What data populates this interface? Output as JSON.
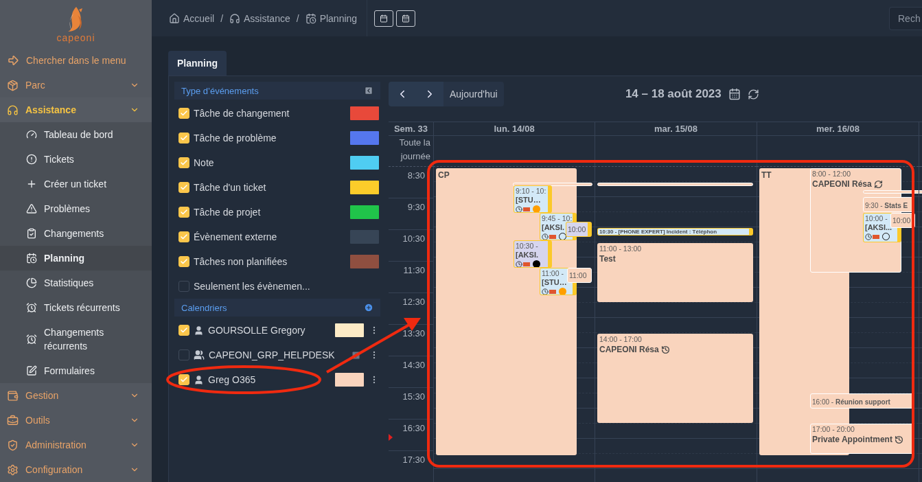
{
  "sidebar": {
    "logo": "capeoni",
    "menu_search": "Chercher dans le menu",
    "sections": [
      {
        "label": "Parc",
        "selected": false
      },
      {
        "label": "Assistance",
        "selected": true,
        "children": [
          {
            "label": "Tableau de bord",
            "selected": false
          },
          {
            "label": "Tickets",
            "selected": false
          },
          {
            "label": "Créer un ticket",
            "selected": false
          },
          {
            "label": "Problèmes",
            "selected": false
          },
          {
            "label": "Changements",
            "selected": false
          },
          {
            "label": "Planning",
            "selected": true
          },
          {
            "label": "Statistiques",
            "selected": false
          },
          {
            "label": "Tickets récurrents",
            "selected": false
          },
          {
            "label": "Changements récurrents",
            "selected": false
          },
          {
            "label": "Formulaires",
            "selected": false
          }
        ]
      },
      {
        "label": "Gestion",
        "selected": false
      },
      {
        "label": "Outils",
        "selected": false
      },
      {
        "label": "Administration",
        "selected": false
      },
      {
        "label": "Configuration",
        "selected": false
      }
    ]
  },
  "breadcrumbs": [
    "Accueil",
    "Assistance",
    "Planning"
  ],
  "breadcrumb_separator": "/",
  "search": {
    "placeholder": "Rech"
  },
  "tabs": [
    {
      "label": "Planning",
      "selected": true
    }
  ],
  "filters": {
    "event_types_title": "Type d’événements",
    "event_types": [
      {
        "label": "Tâche de changement",
        "checked": true,
        "color": "#e8493a"
      },
      {
        "label": "Tâche de problème",
        "checked": true,
        "color": "#5577ee"
      },
      {
        "label": "Note",
        "checked": true,
        "color": "#4fcdf2"
      },
      {
        "label": "Tâche d'un ticket",
        "checked": true,
        "color": "#fccc2a"
      },
      {
        "label": "Tâche de projet",
        "checked": true,
        "color": "#20c44a"
      },
      {
        "label": "Évènement externe",
        "checked": true,
        "color": "#374556"
      },
      {
        "label": "Tâches non planifiées",
        "checked": true,
        "color": "#8f4f40"
      },
      {
        "label": "Seulement les évènemen...",
        "checked": false
      }
    ],
    "calendars_title": "Calendriers",
    "calendars": [
      {
        "label": "GOURSOLLE Gregory",
        "checked": true,
        "kind": "user",
        "color": "#fdebc6"
      },
      {
        "label": "CAPEONI_GRP_HELPDESK",
        "checked": false,
        "kind": "group"
      },
      {
        "label": "Greg O365",
        "checked": true,
        "kind": "user",
        "color": "#f9d4bd"
      }
    ]
  },
  "calendar": {
    "today_button": "Aujourd'hui",
    "title": "14 – 18 août 2023",
    "week": "Sem. 33",
    "all_day": "Toute la journée",
    "times": [
      "8:30",
      "9:30",
      "10:30",
      "11:30",
      "12:30",
      "13:30",
      "14:30",
      "15:30",
      "16:30",
      "17:30"
    ],
    "days": [
      {
        "label": "lun. 14/08",
        "events": [
          {
            "kind": "block",
            "title": "CP"
          },
          {
            "kind": "bar"
          },
          {
            "kind": "ticket",
            "time": "9:10 - 10:",
            "title": "[STU…",
            "color": "#d3e9f7",
            "status": {
              "color": "#ff9f00"
            }
          },
          {
            "kind": "ticket",
            "time": "9:45 - 10:",
            "title": "[AKSI.",
            "color": "#d3e9f7"
          },
          {
            "kind": "mini",
            "time": "10:00",
            "color": "#d6d5ee"
          },
          {
            "kind": "ticket",
            "time": "10:30 -",
            "title": "[AKSI.",
            "color": "#d6d5ee",
            "status": {
              "color": "#000000"
            }
          },
          {
            "kind": "ticket",
            "time": "11:00 -",
            "title": "[STU…",
            "color": "#d3e9f7",
            "status": {
              "color": "#ff9f00"
            }
          },
          {
            "kind": "mini",
            "time": "11:00",
            "color": "#f9d4bd"
          }
        ]
      },
      {
        "label": "mar. 15/08",
        "events": [
          {
            "kind": "bar"
          },
          {
            "kind": "line",
            "title": "10:30 - [PHONE EXPERT] Incident : Téléphon"
          },
          {
            "kind": "block",
            "time": "11:00 - 13:00",
            "title": "Test"
          },
          {
            "kind": "block",
            "time": "14:00 - 17:00",
            "title": "CAPEONI Résa",
            "recurring": true
          }
        ]
      },
      {
        "label": "mer. 16/08",
        "events": [
          {
            "kind": "block",
            "title": "TT"
          },
          {
            "kind": "block",
            "time": "8:00 - 12:00",
            "title": "CAPEONI Résa",
            "synced": true
          },
          {
            "kind": "bar"
          },
          {
            "kind": "inline",
            "time": "9:30 -",
            "title": "Stats E"
          },
          {
            "kind": "ticket",
            "time": "10:00 -",
            "title": "[AKSI...",
            "color": "#d3e9f7"
          },
          {
            "kind": "mini",
            "time": "10:00",
            "color": "#f9d4bd"
          },
          {
            "kind": "inline",
            "time": "16:00 -",
            "title": "Réunion support"
          },
          {
            "kind": "block",
            "time": "17:00 - 20:00",
            "title": "Private Appointment",
            "recurring": true
          }
        ]
      }
    ]
  }
}
